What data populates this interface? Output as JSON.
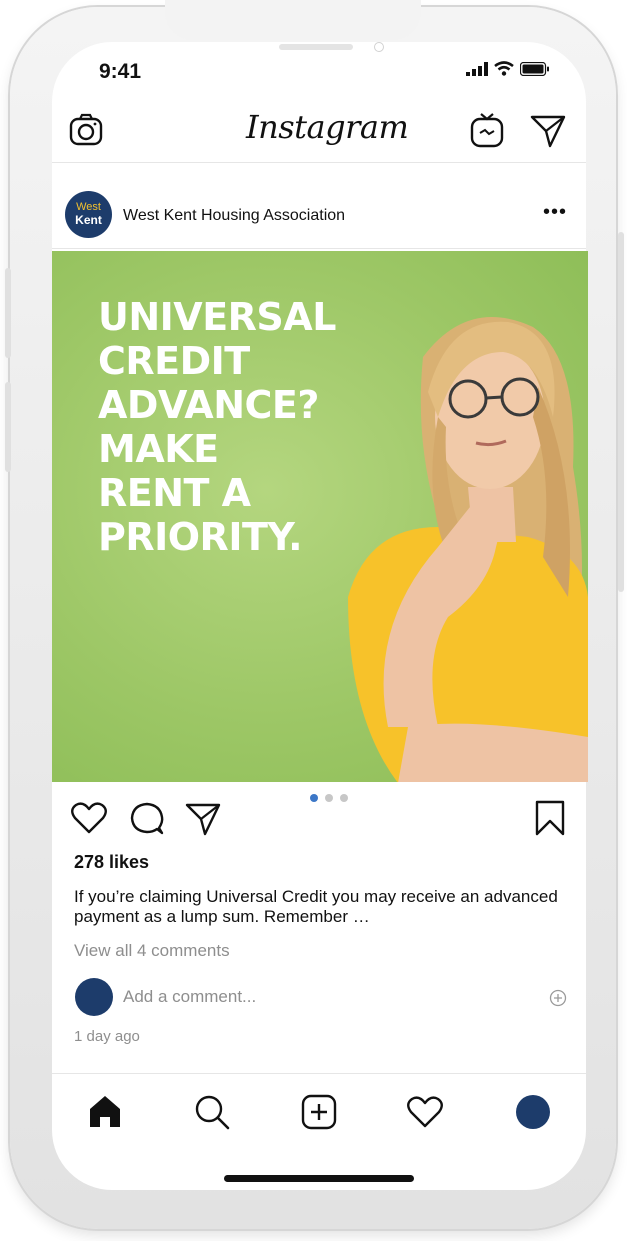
{
  "status_bar": {
    "time": "9:41"
  },
  "header": {
    "logo": "Instagram"
  },
  "post": {
    "avatar": {
      "line1": "West",
      "line2": "Kent"
    },
    "account_name": "West Kent Housing Association",
    "more": "•••",
    "image_text": [
      "UNIVERSAL",
      "CREDIT",
      "ADVANCE?",
      "MAKE",
      "RENT A",
      "PRIORITY."
    ],
    "carousel": {
      "count": 3,
      "active_index": 0
    },
    "likes": "278 likes",
    "caption": "If you’re claiming Universal Credit you may receive an advanced payment as a lump sum. Remember …",
    "view_comments": "View all 4 comments",
    "add_comment_placeholder": "Add a comment...",
    "time_ago": "1 day ago"
  },
  "colors": {
    "brand_navy": "#1d3c6b",
    "image_green": "#9dc766",
    "active_dot": "#3c77c7"
  },
  "icons": {
    "header": [
      "camera-icon",
      "igtv-icon",
      "direct-message-icon"
    ],
    "actions": [
      "heart-icon",
      "comment-icon",
      "share-icon",
      "bookmark-icon"
    ],
    "tabs": [
      "home-icon",
      "search-icon",
      "new-post-icon",
      "activity-icon",
      "profile-avatar"
    ]
  }
}
